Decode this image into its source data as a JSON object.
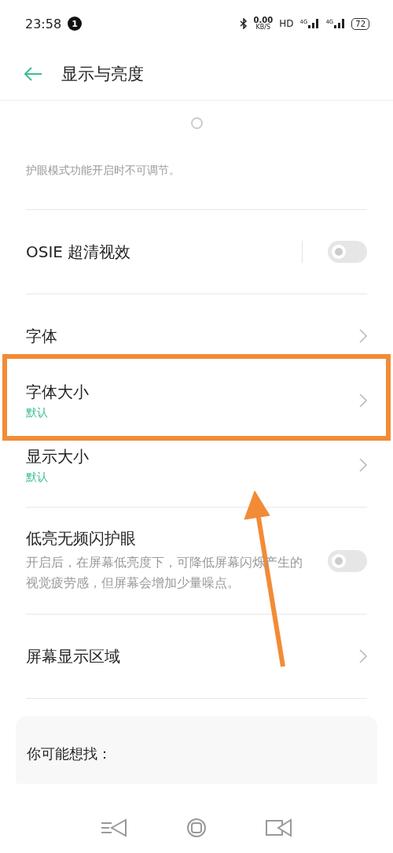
{
  "status_bar": {
    "time": "23:58",
    "notification_count": "1",
    "net_speed": "0.00",
    "net_speed_unit": "KB/S",
    "hd": "HD",
    "signal_1": "4G",
    "signal_2": "4G",
    "battery": "72"
  },
  "header": {
    "title": "显示与亮度"
  },
  "brightness": {
    "level": 0.5,
    "note": "护眼模式功能开启时不可调节。"
  },
  "sections": [
    {
      "items": [
        {
          "kind": "toggle",
          "title": "OSIE 超清视效",
          "on": false,
          "highlighted": false
        }
      ]
    },
    {
      "items": [
        {
          "kind": "link",
          "title": "字体",
          "highlighted": false
        },
        {
          "kind": "link",
          "title": "字体大小",
          "value": "默认",
          "highlighted": true
        },
        {
          "kind": "link",
          "title": "显示大小",
          "value": "默认",
          "highlighted": false
        }
      ]
    },
    {
      "items": [
        {
          "kind": "toggle",
          "title": "低亮无频闪护眼",
          "description": "开启后，在屏幕低亮度下，可降低屏幕闪烁产生的视觉疲劳感，但屏幕会增加少量噪点。",
          "on": false,
          "highlighted": false
        }
      ]
    },
    {
      "items": [
        {
          "kind": "link",
          "title": "屏幕显示区域",
          "highlighted": false
        }
      ]
    }
  ],
  "suggestions": {
    "title": "你可能想找："
  }
}
